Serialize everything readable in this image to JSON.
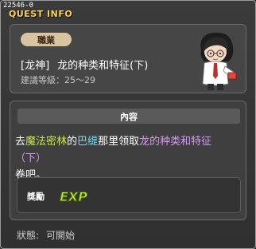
{
  "window": {
    "quest_id": "22546-0",
    "title": "QUEST INFO"
  },
  "info": {
    "job_badge": "職業",
    "quest_category": "[龙神]",
    "quest_name": "龙的种类和特征(下)",
    "req_level_label": "建議等級：",
    "req_level_value": "25～29",
    "npc_icon": "npc-scholar-portrait-icon"
  },
  "content": {
    "header": "內容",
    "text_parts": {
      "p1": "去",
      "place": "魔法密林",
      "p2": "的",
      "npc": "巴缇",
      "p3": "那里领取",
      "item": "龙的种类和特征（下）",
      "p4": "卷吧。"
    },
    "reward": {
      "label": "獎勵",
      "exp_icon": "exp-icon",
      "exp_text": "EXP"
    }
  },
  "status": {
    "label": "狀態:",
    "value": "可開始"
  },
  "colors": {
    "title": "#ffd24a",
    "place": "#c8e64c",
    "npc": "#7cd9f0",
    "item": "#d49cf0",
    "exp": "#b6e637",
    "badge": "#d9c3a1"
  }
}
